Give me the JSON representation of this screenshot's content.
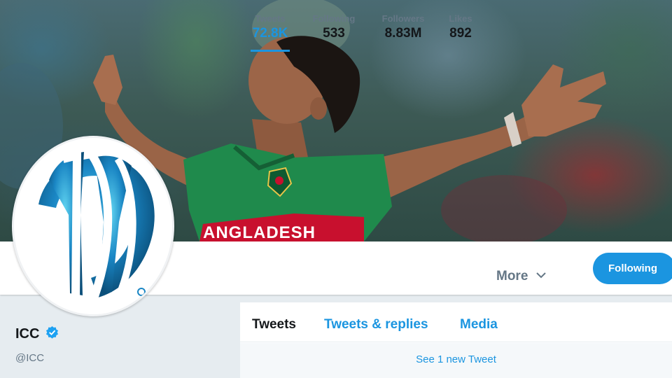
{
  "profile": {
    "name": "ICC",
    "handle": "@ICC",
    "verified": true,
    "jersey_text": "ANGLADESH"
  },
  "stats": [
    {
      "label": "Tweets",
      "value": "72.8K",
      "active": true
    },
    {
      "label": "Following",
      "value": "533",
      "active": false
    },
    {
      "label": "Followers",
      "value": "8.83M",
      "active": false
    },
    {
      "label": "Likes",
      "value": "892",
      "active": false
    }
  ],
  "more_label": "More",
  "follow_button_label": "Following",
  "timeline": {
    "tabs": [
      {
        "label": "Tweets",
        "active": true
      },
      {
        "label": "Tweets & replies",
        "active": false
      },
      {
        "label": "Media",
        "active": false
      }
    ],
    "new_tweet_notice": "See 1 new Tweet"
  },
  "icons": {
    "verified": "verified-badge-icon",
    "chevron": "chevron-down-icon",
    "logo": "icc-logo"
  },
  "colors": {
    "accent": "#1b95e0",
    "text_primary": "#14171a",
    "text_secondary": "#657786",
    "jersey_green": "#1f8a4c",
    "jersey_red": "#c8102e"
  }
}
